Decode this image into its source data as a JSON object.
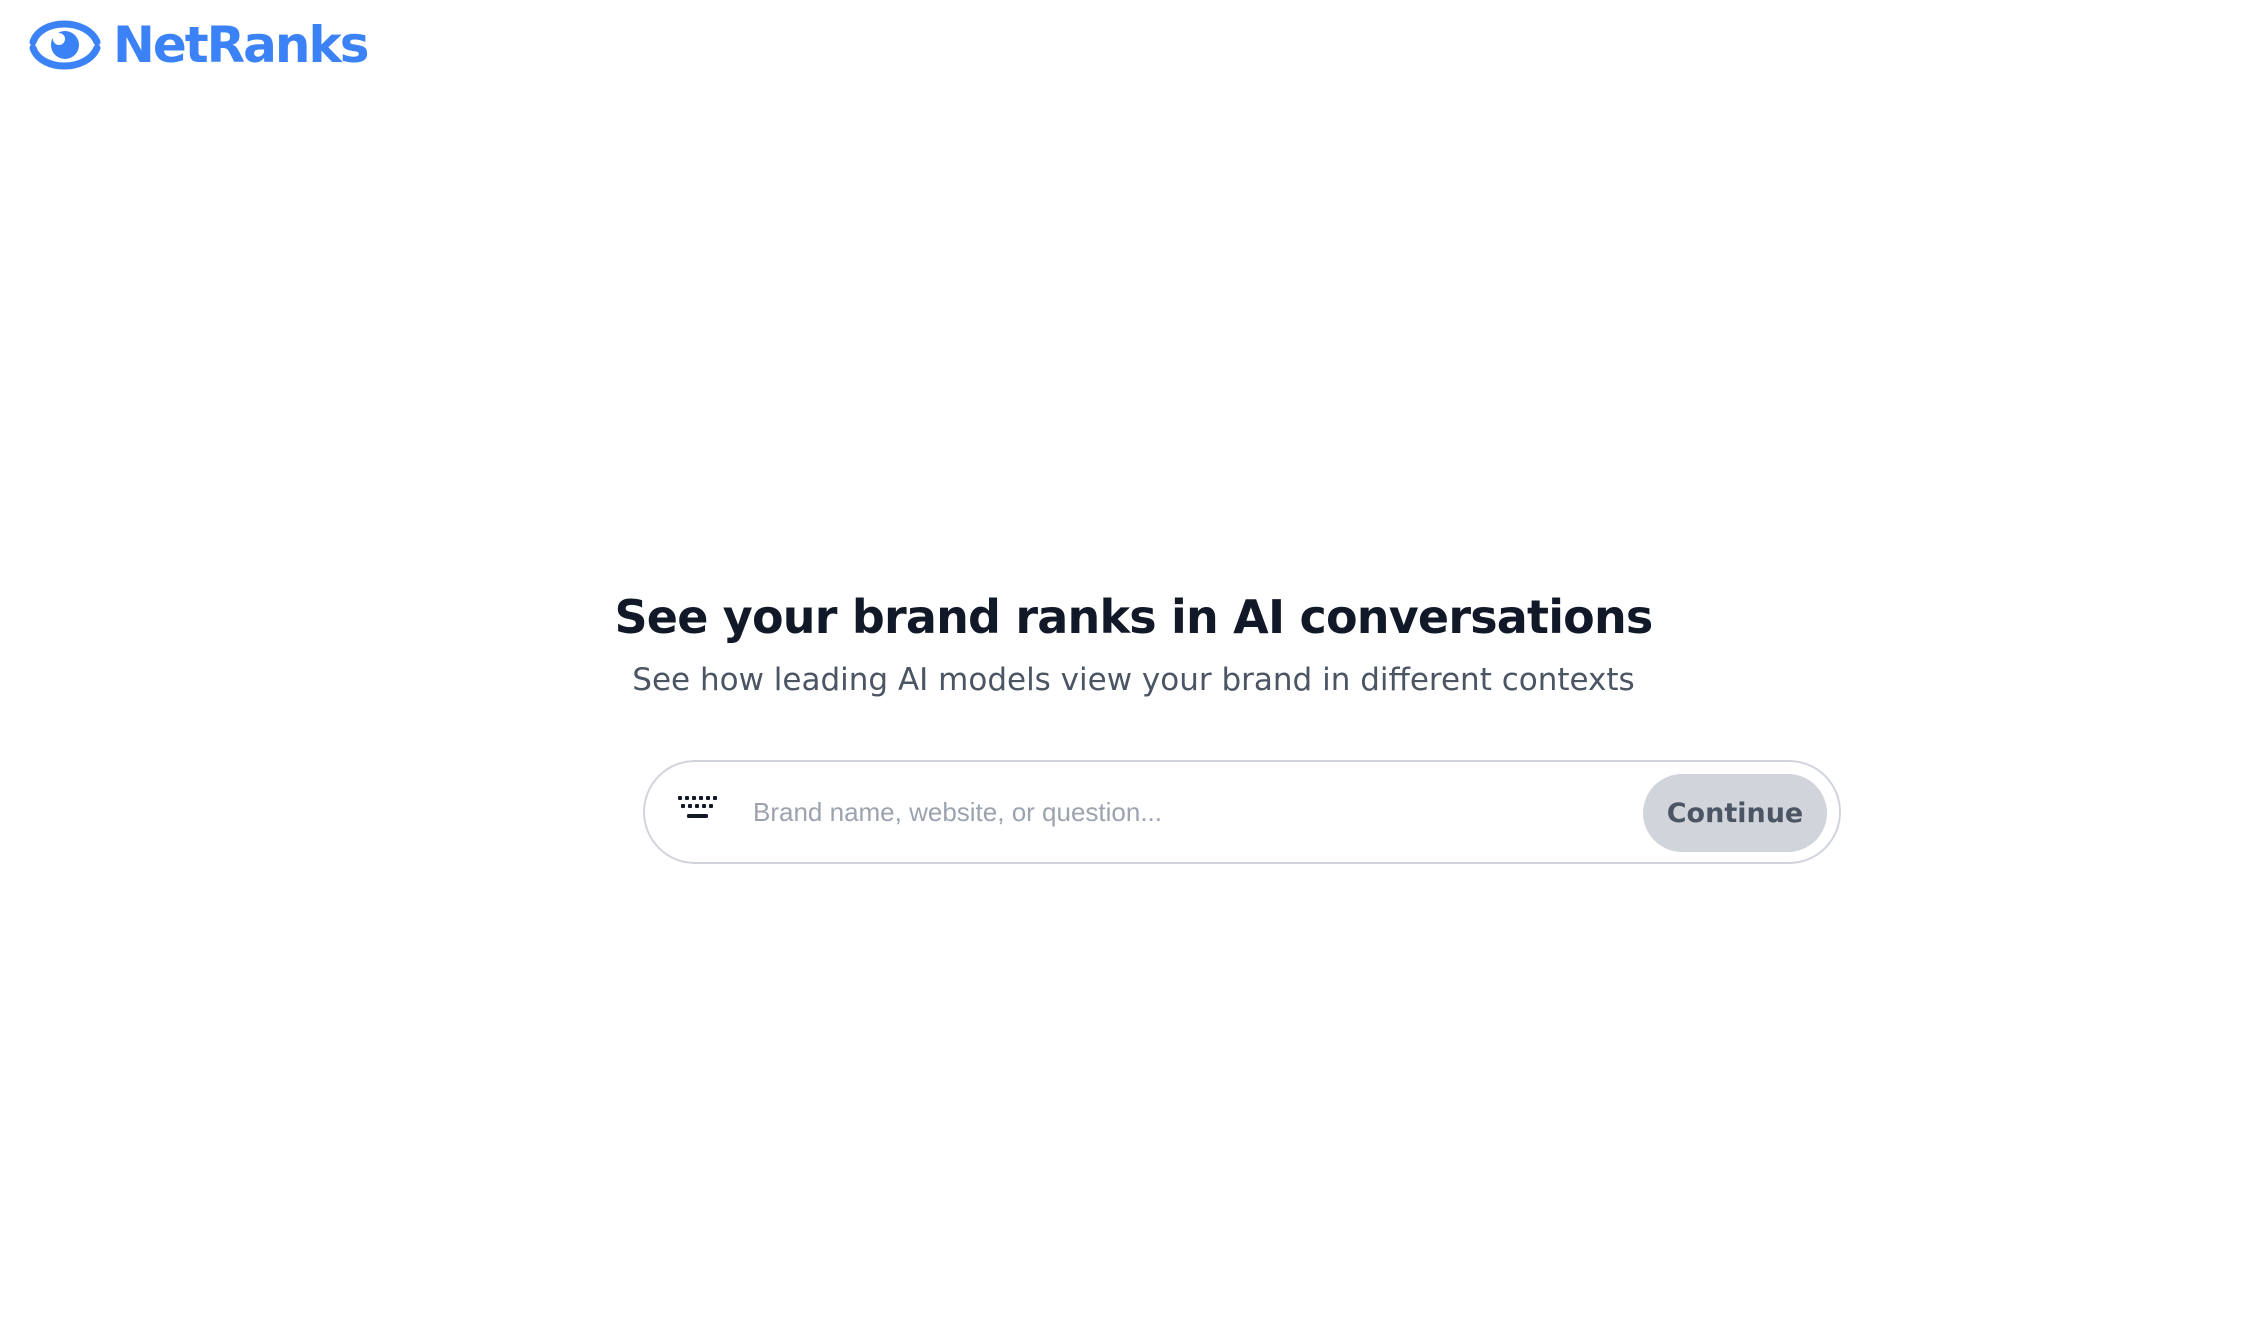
{
  "brand": {
    "name": "NetRanks",
    "logo_icon": "eye-icon",
    "color": "#3b82f6"
  },
  "hero": {
    "title": "See your brand ranks in AI conversations",
    "subtitle": "See how leading AI models view your brand in different contexts"
  },
  "search": {
    "icon": "keyboard-icon",
    "placeholder": "Brand name, website, or question...",
    "value": "",
    "button_label": "Continue"
  }
}
